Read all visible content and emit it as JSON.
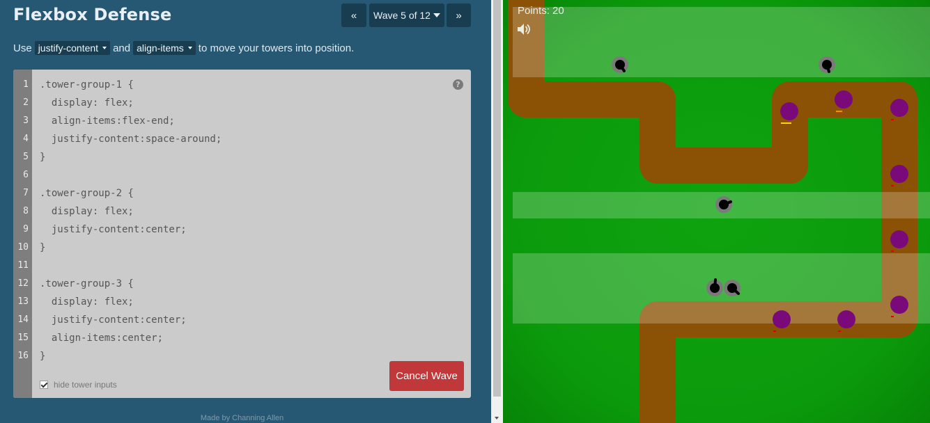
{
  "app": {
    "title": "Flexbox Defense"
  },
  "nav": {
    "prev_label": "«",
    "wave_label": "Wave 5 of 12",
    "next_label": "»"
  },
  "instructions": {
    "prefix": "Use",
    "select1": "justify-content",
    "middle": "and",
    "select2": "align-items",
    "suffix": "to move your towers into position."
  },
  "editor": {
    "lines": [
      {
        "n": "1",
        "text": ".tower-group-1 {"
      },
      {
        "n": "2",
        "text": "  display: flex;"
      },
      {
        "n": "3",
        "text": "  align-items:flex-end;"
      },
      {
        "n": "4",
        "text": "  justify-content:space-around;"
      },
      {
        "n": "5",
        "text": "}"
      },
      {
        "n": "6",
        "text": ""
      },
      {
        "n": "7",
        "text": ".tower-group-2 {"
      },
      {
        "n": "8",
        "text": "  display: flex;"
      },
      {
        "n": "9",
        "text": "  justify-content:center;"
      },
      {
        "n": "10",
        "text": "}"
      },
      {
        "n": "11",
        "text": ""
      },
      {
        "n": "12",
        "text": ".tower-group-3 {"
      },
      {
        "n": "13",
        "text": "  display: flex;"
      },
      {
        "n": "14",
        "text": "  justify-content:center;"
      },
      {
        "n": "15",
        "text": "  align-items:center;"
      },
      {
        "n": "16",
        "text": "}"
      }
    ],
    "help_label": "?",
    "hide_inputs_label": "hide tower inputs",
    "hide_inputs_checked": true,
    "cancel_label": "Cancel Wave"
  },
  "footer": {
    "credit": "Made by Channing Allen"
  },
  "game": {
    "points_label": "Points: 20",
    "sound_icon": "speaker-icon",
    "colors": {
      "grass": "#0a9c0a",
      "path": "#8b5105",
      "enemy": "#7a0a7a",
      "tower_base": "#7a7a7a",
      "tower": "#000000",
      "zone": "#ffffff"
    }
  }
}
